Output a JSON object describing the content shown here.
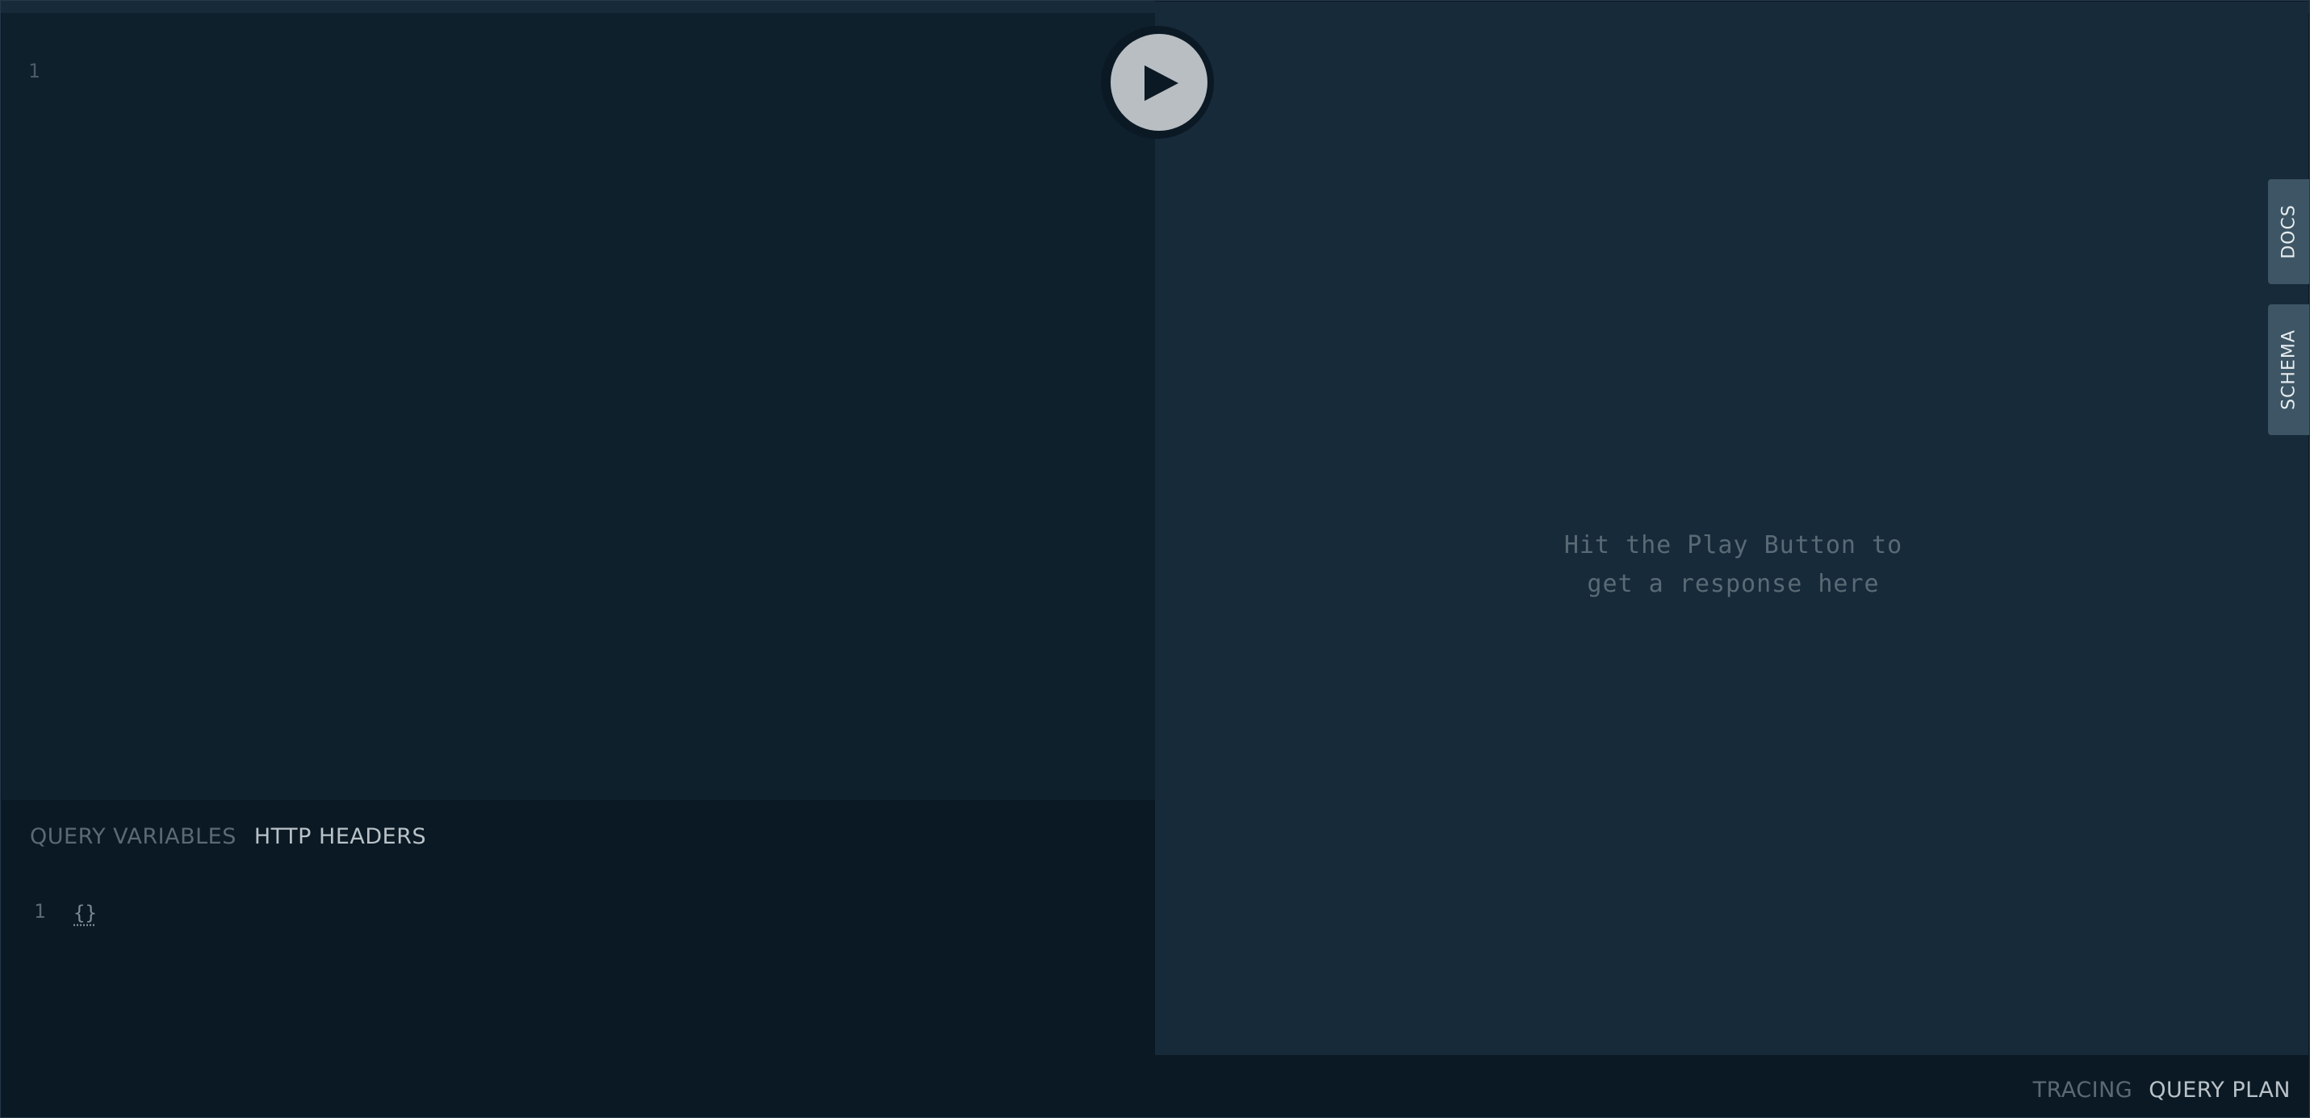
{
  "query_editor": {
    "line_number": "1"
  },
  "bottom_panel": {
    "tabs": [
      {
        "label": "QUERY VARIABLES",
        "active": false
      },
      {
        "label": "HTTP HEADERS",
        "active": true
      }
    ],
    "line_number": "1",
    "content": "{}"
  },
  "result": {
    "placeholder_line1": "Hit the Play Button to",
    "placeholder_line2": "get a response here"
  },
  "side_tabs": {
    "docs": "DOCS",
    "schema": "SCHEMA"
  },
  "bottom_bar": {
    "tabs": [
      {
        "label": "TRACING",
        "active": false
      },
      {
        "label": "QUERY PLAN",
        "active": true
      }
    ]
  },
  "icons": {
    "play": "play-icon"
  },
  "colors": {
    "editor_bg": "#0f202d",
    "result_bg": "#172a3a",
    "panel_bg": "#0b1924",
    "side_tab_bg": "#3d5564",
    "play_button": "#b9bec3"
  }
}
